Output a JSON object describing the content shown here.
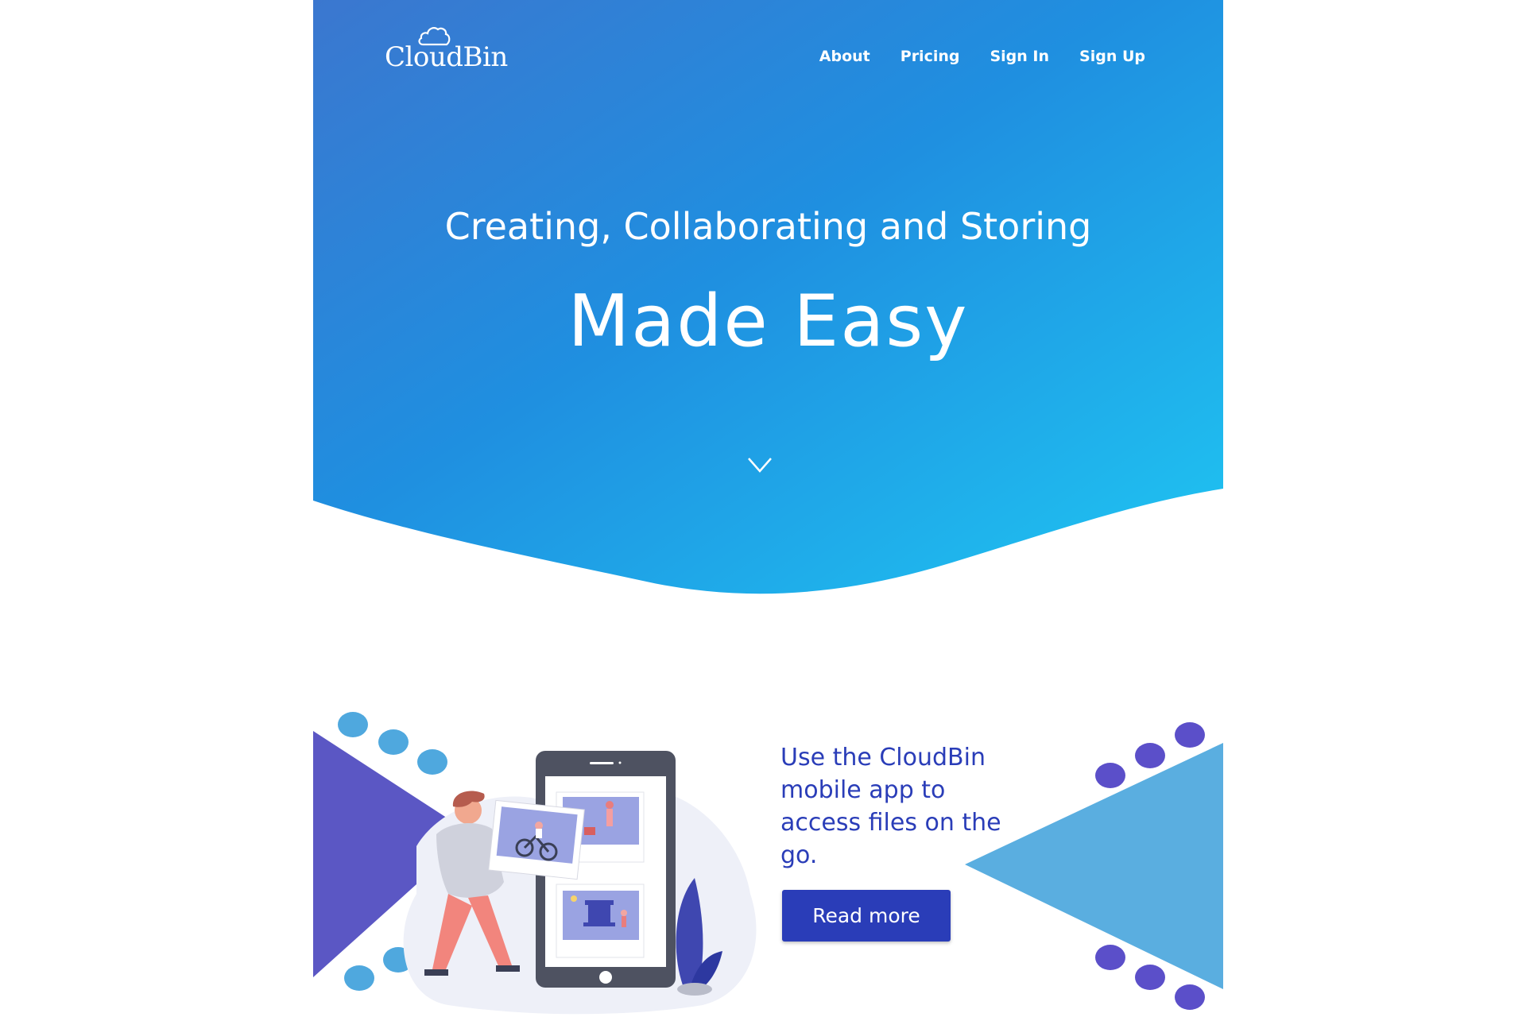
{
  "brand": {
    "name": "CloudBin",
    "colors": {
      "hero_gradient_start": "#3a7bd5",
      "hero_gradient_end": "#1ec0f0",
      "accent": "#2a3db8",
      "purple": "#5b57c4",
      "light_blue": "#5aaee0",
      "dots_blue": "#4fa8de",
      "dots_purple": "#5b4fc9"
    }
  },
  "nav": {
    "items": [
      {
        "label": "About"
      },
      {
        "label": "Pricing"
      },
      {
        "label": "Sign In"
      },
      {
        "label": "Sign Up"
      }
    ]
  },
  "hero": {
    "subtitle": "Creating, Collaborating and Storing",
    "title": "Made Easy",
    "scroll_icon": "chevron-down-icon"
  },
  "promo": {
    "text": "Use the CloudBin mobile app to access files on the go.",
    "button_label": "Read more",
    "illustration": "person-with-phone-illustration"
  }
}
